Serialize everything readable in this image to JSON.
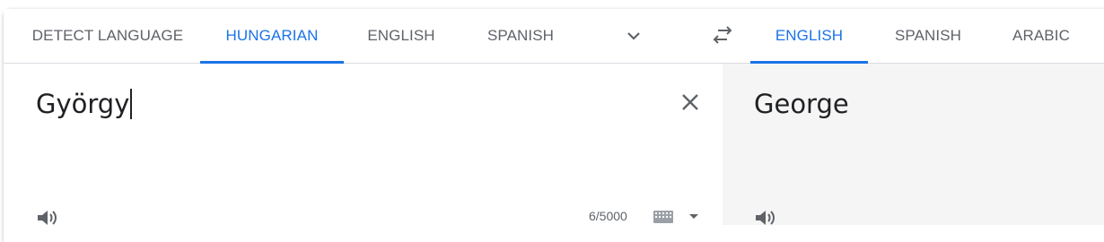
{
  "source_tabs": [
    {
      "label": "DETECT LANGUAGE",
      "active": false
    },
    {
      "label": "HUNGARIAN",
      "active": true
    },
    {
      "label": "ENGLISH",
      "active": false
    },
    {
      "label": "SPANISH",
      "active": false
    }
  ],
  "target_tabs": [
    {
      "label": "ENGLISH",
      "active": true
    },
    {
      "label": "SPANISH",
      "active": false
    },
    {
      "label": "ARABIC",
      "active": false
    }
  ],
  "source": {
    "text": "György",
    "char_count": "6/5000"
  },
  "target": {
    "text": "George"
  },
  "icons": {
    "more_languages": "chevron-down-icon",
    "swap": "swap-languages-icon",
    "clear": "close-icon",
    "speaker": "speaker-icon",
    "keyboard": "keyboard-icon"
  },
  "colors": {
    "accent": "#1a73e8",
    "text": "#202124",
    "muted": "#5f6368",
    "target_bg": "#f5f5f5"
  }
}
